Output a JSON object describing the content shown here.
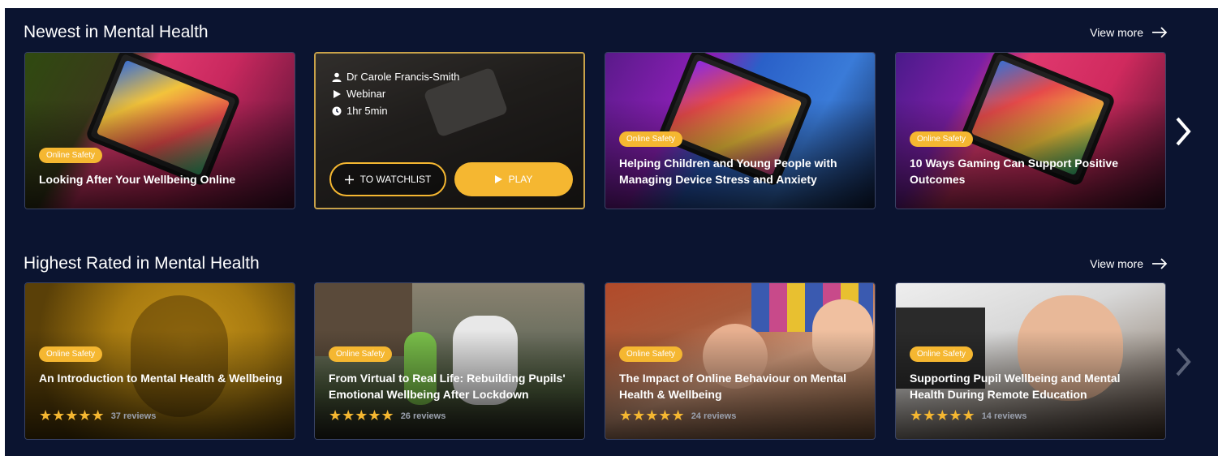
{
  "sections": [
    {
      "title": "Newest in Mental Health",
      "view_more": "View more",
      "cards": [
        {
          "badge": "Online Safety",
          "title": "Looking After Your Wellbeing Online"
        },
        {
          "author": "Dr Carole Francis-Smith",
          "format": "Webinar",
          "duration": "1hr 5min",
          "watchlist_label": "TO WATCHLIST",
          "play_label": "PLAY"
        },
        {
          "badge": "Online Safety",
          "title": "Helping Children and Young People with Managing Device Stress and Anxiety"
        },
        {
          "badge": "Online Safety",
          "title": "10 Ways Gaming Can Support Positive Outcomes"
        }
      ]
    },
    {
      "title": "Highest Rated in Mental Health",
      "view_more": "View more",
      "cards": [
        {
          "badge": "Online Safety",
          "title": "An Introduction to Mental Health & Wellbeing",
          "rating": 5,
          "reviews": "37 reviews"
        },
        {
          "badge": "Online Safety",
          "title": "From Virtual to Real Life: Rebuilding Pupils' Emotional Wellbeing After Lockdown",
          "rating": 5,
          "reviews": "26 reviews"
        },
        {
          "badge": "Online Safety",
          "title": "The Impact of Online Behaviour on Mental Health & Wellbeing",
          "rating": 5,
          "reviews": "24 reviews"
        },
        {
          "badge": "Online Safety",
          "title": "Supporting Pupil Wellbeing and Mental Health During Remote Education",
          "rating": 5,
          "reviews": "14 reviews"
        }
      ]
    }
  ],
  "stars_text": "★★★★★",
  "colors": {
    "background": "#0b1430",
    "accent": "#f5b731",
    "text": "#ffffff"
  },
  "icons": [
    "arrow-right-icon",
    "chevron-right-icon",
    "user-icon",
    "play-icon",
    "clock-icon",
    "plus-icon",
    "star-icon"
  ]
}
